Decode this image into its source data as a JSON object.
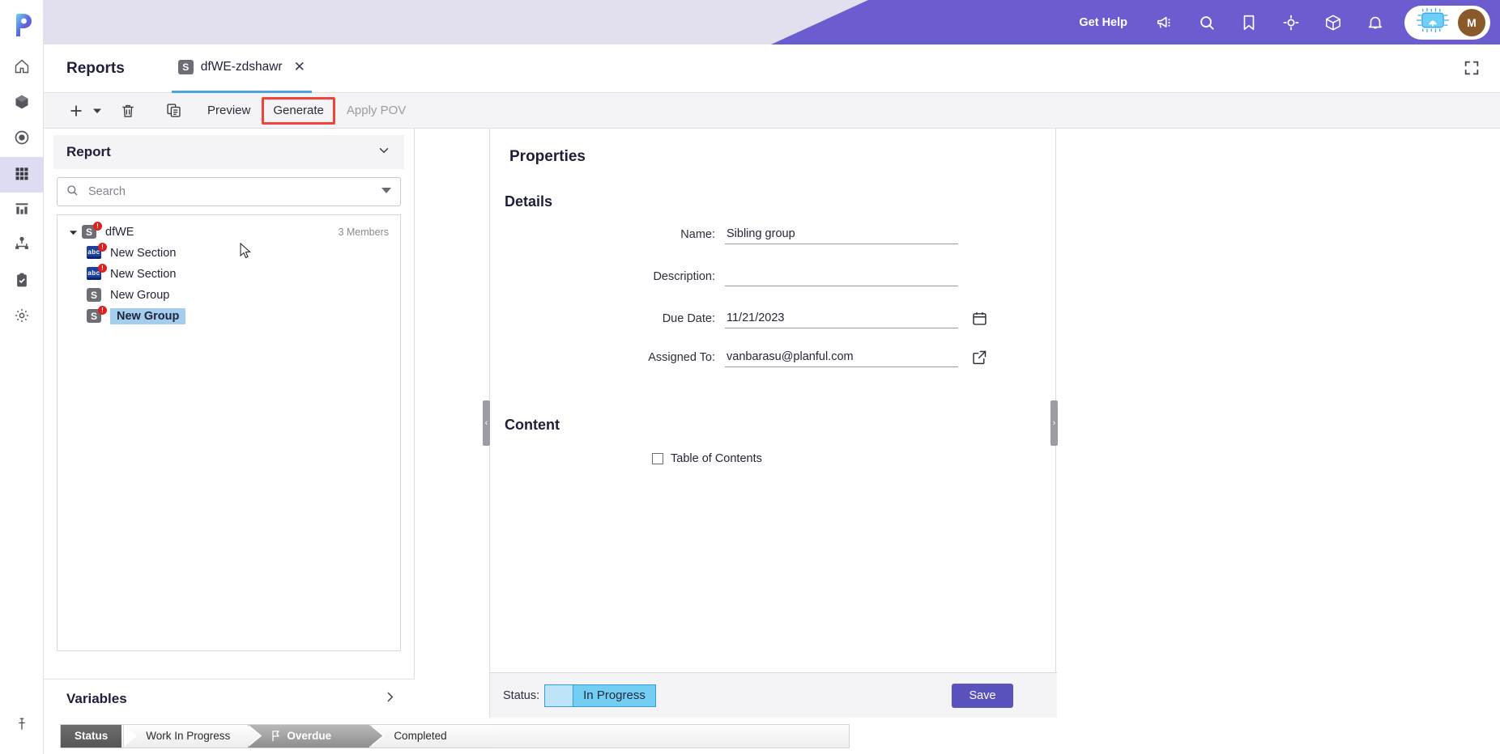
{
  "brand": {
    "accent_purple": "#6b5ccf",
    "header_bg": "#e2dfee",
    "tab_underline": "#4da3e0",
    "highlight_red": "#f04438",
    "selection_blue": "#a3ceee",
    "status_blue": "#74cdf2",
    "save_button": "#5a52bd"
  },
  "rail": {
    "logo": "planful-logo",
    "items": [
      {
        "name": "home-icon",
        "label": "Home",
        "active": false
      },
      {
        "name": "package-icon",
        "label": "Modeling",
        "active": false
      },
      {
        "name": "target-icon",
        "label": "Scenarios",
        "active": false
      },
      {
        "name": "grid-icon",
        "label": "Reports",
        "active": true
      },
      {
        "name": "chart-icon",
        "label": "Dashboards",
        "active": false
      },
      {
        "name": "hierarchy-icon",
        "label": "Structures",
        "active": false
      },
      {
        "name": "clipboard-check-icon",
        "label": "Tasks",
        "active": false
      },
      {
        "name": "gear-icon",
        "label": "Settings",
        "active": false
      }
    ],
    "pin": "pin-icon"
  },
  "header": {
    "get_help_label": "Get Help",
    "icons": [
      {
        "name": "announcement-icon"
      },
      {
        "name": "search-icon"
      },
      {
        "name": "bookmark-icon"
      },
      {
        "name": "target-crosshair-icon"
      },
      {
        "name": "cube-icon"
      },
      {
        "name": "bell-icon"
      }
    ],
    "assistant_icon": "ai-chip-icon",
    "avatar_initial": "M"
  },
  "tabbar": {
    "module_title": "Reports",
    "document_tab": {
      "icon": "group-icon",
      "label": "dfWE-zdshawr",
      "close": "close-icon"
    },
    "expand_icon": "fullscreen-icon"
  },
  "toolbar": {
    "add_icon": "plus-icon",
    "add_caret": "chevron-down-icon",
    "delete_icon": "trash-icon",
    "copy_icon": "copy-icon",
    "preview_label": "Preview",
    "generate_label": "Generate",
    "apply_pov_label": "Apply POV"
  },
  "left_panel": {
    "title": "Report",
    "collapse_icon": "chevron-down-icon",
    "search": {
      "icon": "search-icon",
      "placeholder": "Search",
      "value": "",
      "dropdown_icon": "filter-caret-icon"
    },
    "tree": {
      "root": {
        "label": "dfWE",
        "icon": "group-icon",
        "error_badge": "!",
        "member_count": "3 Members",
        "expanded": true
      },
      "children": [
        {
          "label": "New Section",
          "icon": "section-abc-icon",
          "error_badge": "!",
          "selected": false
        },
        {
          "label": "New Section",
          "icon": "section-abc-icon",
          "error_badge": "!",
          "selected": false
        },
        {
          "label": "New Group",
          "icon": "group-icon",
          "error_badge": "",
          "selected": false
        },
        {
          "label": "New Group",
          "icon": "group-icon",
          "error_badge": "!",
          "selected": true
        }
      ]
    },
    "variables": {
      "title": "Variables",
      "expand_icon": "chevron-right-icon"
    }
  },
  "properties": {
    "title": "Properties",
    "details_title": "Details",
    "fields": [
      {
        "label": "Name:",
        "value": "Sibling group",
        "placeholder": "",
        "icon": ""
      },
      {
        "label": "Description:",
        "value": "",
        "placeholder": "",
        "icon": ""
      },
      {
        "label": "Due Date:",
        "value": "11/21/2023",
        "placeholder": "",
        "icon": "calendar-icon"
      },
      {
        "label": "Assigned To:",
        "value": "vanbarasu@planful.com",
        "placeholder": "",
        "icon": "external-link-icon"
      }
    ],
    "content_title": "Content",
    "table_of_contents": {
      "label": "Table of Contents",
      "checked": false
    },
    "footer": {
      "status_label": "Status:",
      "status_value": "In Progress",
      "save_label": "Save"
    }
  },
  "statusbar": {
    "head_label": "Status",
    "steps": [
      {
        "label": "Work In Progress",
        "active": false,
        "icon": ""
      },
      {
        "label": "Overdue",
        "active": true,
        "icon": "flag-icon"
      },
      {
        "label": "Completed",
        "active": false,
        "icon": ""
      }
    ]
  },
  "handles": {
    "left_collapse": "‹",
    "right_collapse": "›"
  }
}
